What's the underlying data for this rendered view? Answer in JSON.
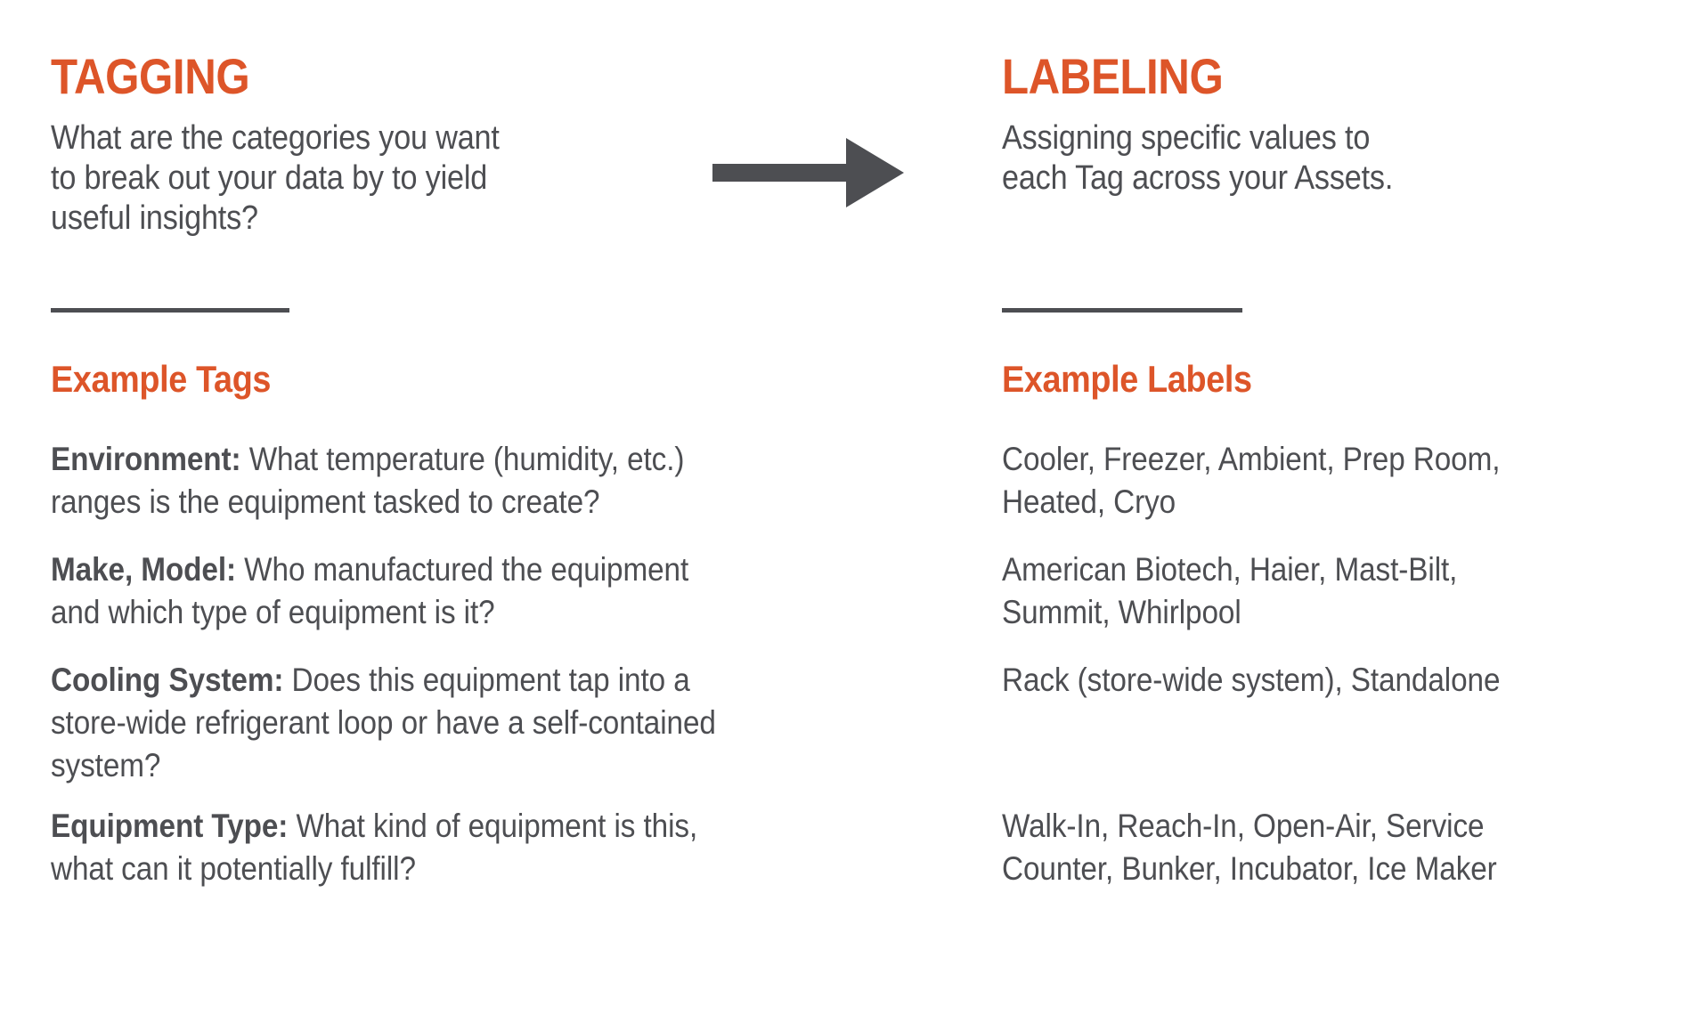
{
  "theme": {
    "accent": "#DD5529",
    "text": "#4D4E52",
    "background": "#FFFFFF"
  },
  "left": {
    "title": "TAGGING",
    "intro": "What are the categories you want\nto break out your data by to yield\nuseful insights?",
    "subtitle": "Example Tags",
    "rows": [
      {
        "lead": "Environment:",
        "text": " What temperature (humidity, etc.)\nranges is the equipment tasked to create?"
      },
      {
        "lead": "Make, Model:",
        "text": " Who manufactured the equipment\nand which type of equipment is it?"
      },
      {
        "lead": "Cooling System:",
        "text": " Does this equipment tap into a\nstore-wide refrigerant loop or have a self-contained\nsystem?"
      },
      {
        "lead": "Equipment Type:",
        "text": " What kind of equipment is this,\nwhat can it potentially fulfill?"
      }
    ]
  },
  "right": {
    "title": "LABELING",
    "intro": "Assigning specific values to\neach Tag across your Assets.",
    "subtitle": "Example Labels",
    "rows": [
      {
        "lead": "",
        "text": "Cooler, Freezer, Ambient, Prep Room,\nHeated, Cryo"
      },
      {
        "lead": "",
        "text": "American Biotech, Haier, Mast-Bilt,\nSummit, Whirlpool"
      },
      {
        "lead": "",
        "text": "Rack (store-wide system), Standalone"
      },
      {
        "lead": "",
        "text": "Walk-In, Reach-In, Open-Air, Service\nCounter, Bunker, Incubator, Ice Maker"
      }
    ]
  },
  "connector": {
    "icon": "right-arrow-icon",
    "color": "#4D4E52"
  }
}
